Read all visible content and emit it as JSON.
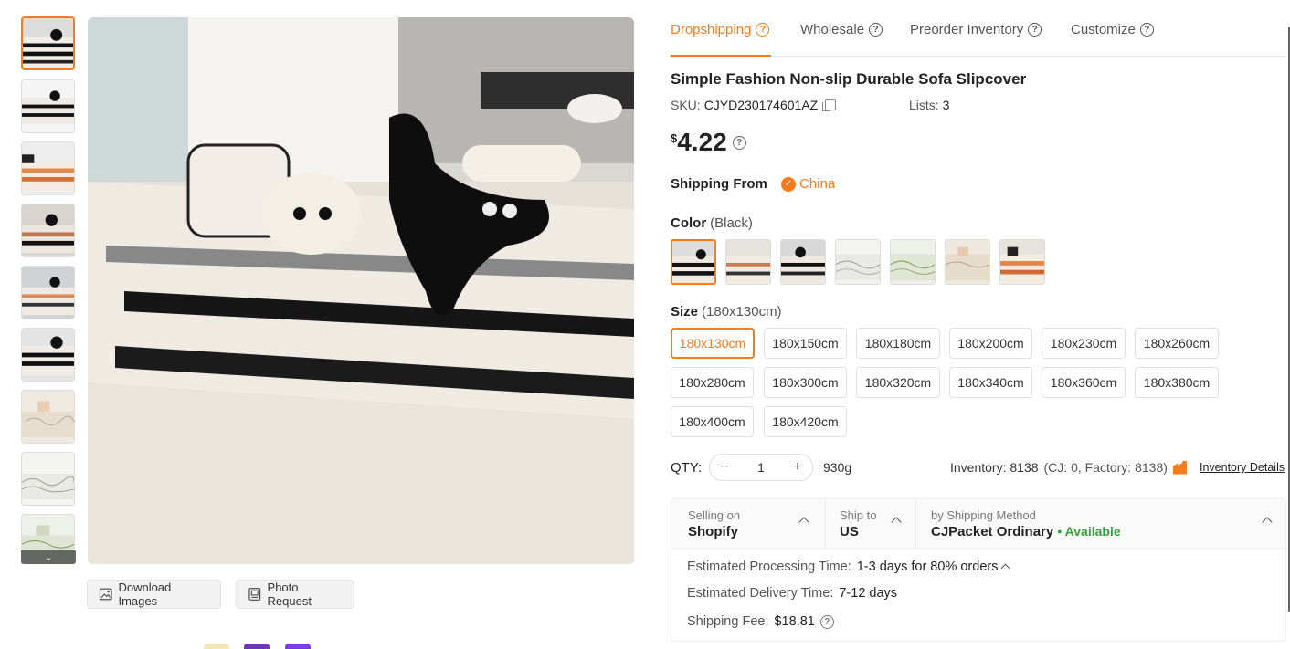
{
  "gallery": {
    "download_label": "Download Images",
    "photo_request_label": "Photo Request"
  },
  "tabs": [
    {
      "label": "Dropshipping"
    },
    {
      "label": "Wholesale"
    },
    {
      "label": "Preorder Inventory"
    },
    {
      "label": "Customize"
    }
  ],
  "product": {
    "title": "Simple Fashion Non-slip Durable Sofa Slipcover",
    "sku_label": "SKU:",
    "sku": "CJYD230174601AZ",
    "lists_label": "Lists:",
    "lists": "3",
    "currency": "$",
    "price": "4.22",
    "shipping_from_label": "Shipping From",
    "shipping_from": "China",
    "color_label": "Color",
    "color_selected": "(Black)",
    "size_label": "Size",
    "size_selected": "(180x130cm)",
    "sizes": [
      "180x130cm",
      "180x150cm",
      "180x180cm",
      "180x200cm",
      "180x230cm",
      "180x260cm",
      "180x280cm",
      "180x300cm",
      "180x320cm",
      "180x340cm",
      "180x360cm",
      "180x380cm",
      "180x400cm",
      "180x420cm"
    ],
    "qty_label": "QTY:",
    "qty": "1",
    "weight": "930g",
    "inventory_label": "Inventory: 8138",
    "inventory_sub": "(CJ: 0, Factory: 8138)",
    "inventory_link": "Inventory Details"
  },
  "shipping": {
    "selling_on_label": "Selling on",
    "selling_on": "Shopify",
    "ship_to_label": "Ship to",
    "ship_to": "US",
    "method_label": "by Shipping Method",
    "method": "CJPacket Ordinary",
    "availability": "• Available",
    "processing_label": "Estimated Processing Time:",
    "processing": "1-3 days for 80% orders",
    "delivery_label": "Estimated Delivery Time:",
    "delivery": "7-12 days",
    "fee_label": "Shipping Fee:",
    "fee": "$18.81"
  },
  "colors": {
    "accent": "#f47c1e",
    "available": "#33a33a"
  }
}
